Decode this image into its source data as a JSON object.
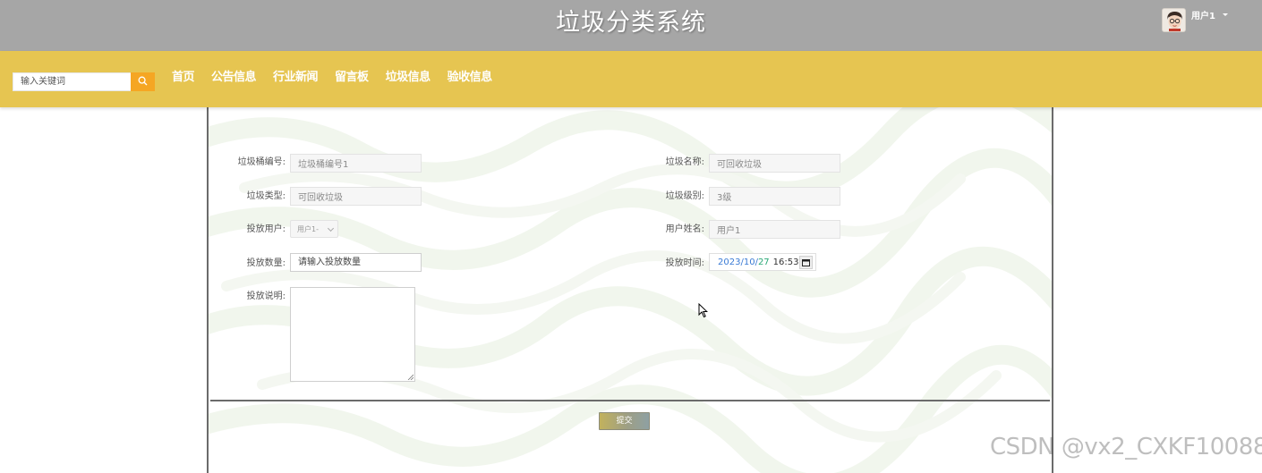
{
  "header": {
    "title": "垃圾分类系统",
    "user_name": "用户1",
    "avatar_icon": "avatar-icon",
    "caret_icon": "caret-down-icon"
  },
  "nav": {
    "search_placeholder": "输入关键词",
    "search_icon": "search-icon",
    "items": [
      "首页",
      "公告信息",
      "行业新闻",
      "留言板",
      "垃圾信息",
      "验收信息"
    ]
  },
  "form": {
    "bin_number": {
      "label": "垃圾桶编号:",
      "value": "垃圾桶编号1"
    },
    "garbage_name": {
      "label": "垃圾名称:",
      "value": "可回收垃圾"
    },
    "garbage_type": {
      "label": "垃圾类型:",
      "value": "可回收垃圾"
    },
    "garbage_level": {
      "label": "垃圾级别:",
      "value": "3级"
    },
    "delivery_user": {
      "label": "投放用户:",
      "value": "用户1-"
    },
    "user_realname": {
      "label": "用户姓名:",
      "value": "用户1"
    },
    "quantity": {
      "label": "投放数量:",
      "placeholder": "请输入投放数量"
    },
    "delivery_time": {
      "label": "投放时间:",
      "year": "2023",
      "sep": "/",
      "month": "10",
      "day": "27",
      "time": "16:53",
      "calendar_icon": "calendar-icon"
    },
    "description": {
      "label": "投放说明:",
      "value": ""
    },
    "submit_label": "提交"
  },
  "watermark": "CSDN @vx2_CXKF10088",
  "colors": {
    "header_bg": "#a6a6a6",
    "nav_bg": "#e6c551",
    "search_button": "#f5a623"
  }
}
